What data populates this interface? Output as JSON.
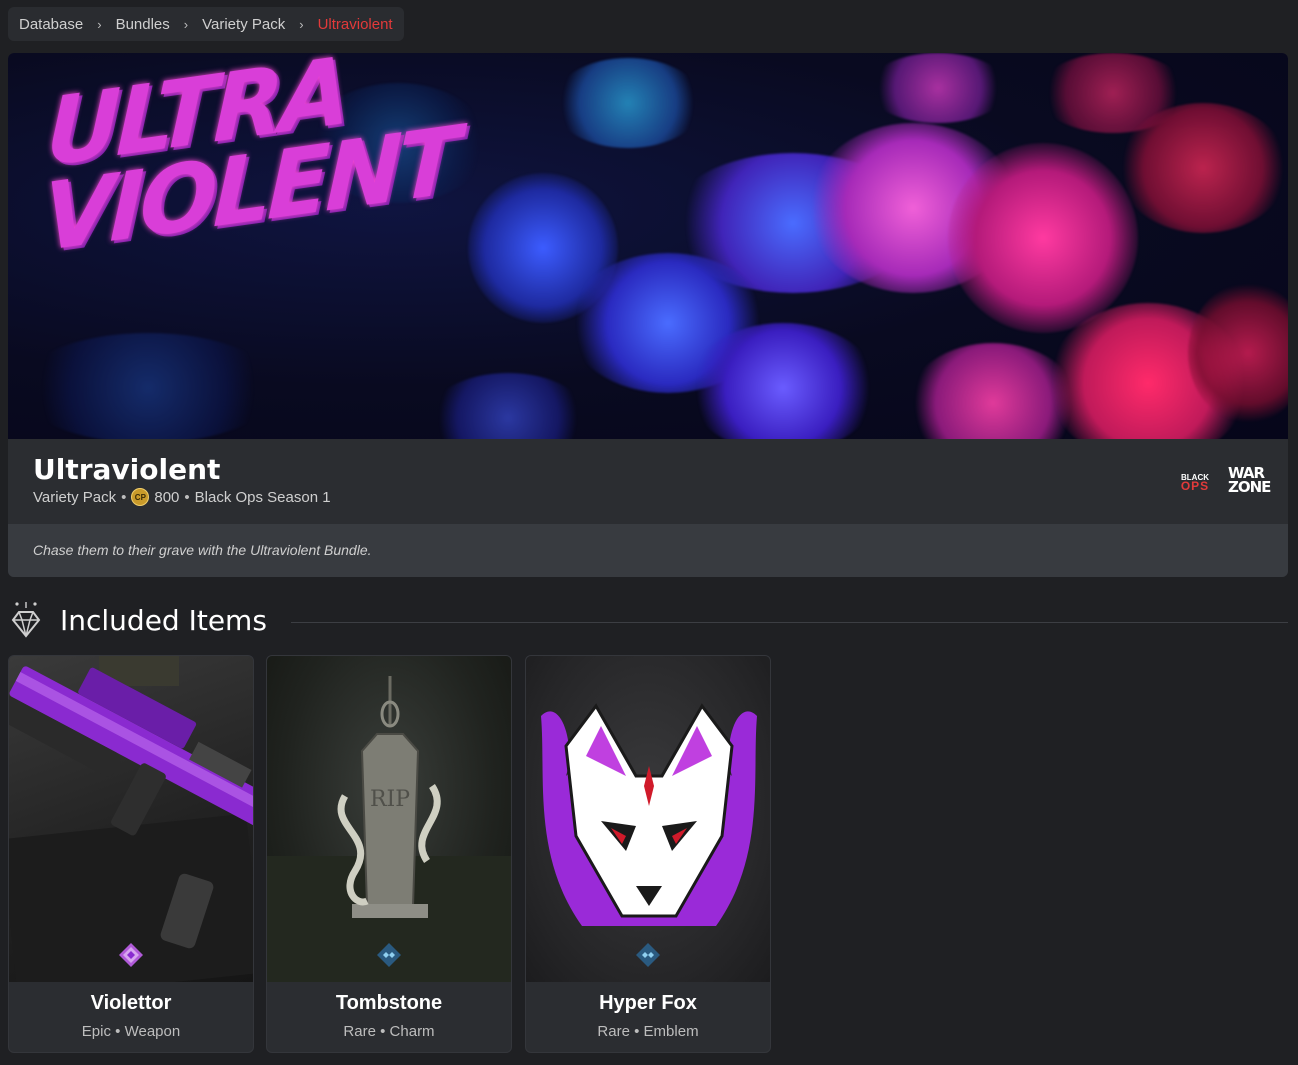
{
  "breadcrumb": {
    "items": [
      "Database",
      "Bundles",
      "Variety Pack",
      "Ultraviolent"
    ],
    "separator": "›",
    "active_color": "#e23a3a"
  },
  "banner": {
    "title": "ULTRA\nVIOLENT"
  },
  "bundle": {
    "name": "Ultraviolent",
    "type": "Variety Pack",
    "currency_icon": "cp-coin-icon",
    "currency_label": "CP",
    "price": "800",
    "season": "Black Ops Season 1",
    "description": "Chase them to their grave with the Ultraviolent Bundle.",
    "logos": {
      "black_ops_top": "BLACK",
      "black_ops_bottom": "OPS",
      "warzone": "WAR\nZONE"
    }
  },
  "section": {
    "icon": "diamond-icon",
    "title": "Included Items"
  },
  "items": [
    {
      "name": "Violettor",
      "rarity": "Epic",
      "type": "Weapon",
      "rarity_color": "#b05ad8"
    },
    {
      "name": "Tombstone",
      "rarity": "Rare",
      "type": "Charm",
      "rarity_color": "#3b8fd0"
    },
    {
      "name": "Hyper Fox",
      "rarity": "Rare",
      "type": "Emblem",
      "rarity_color": "#3b8fd0"
    }
  ],
  "meta_separator": "•"
}
